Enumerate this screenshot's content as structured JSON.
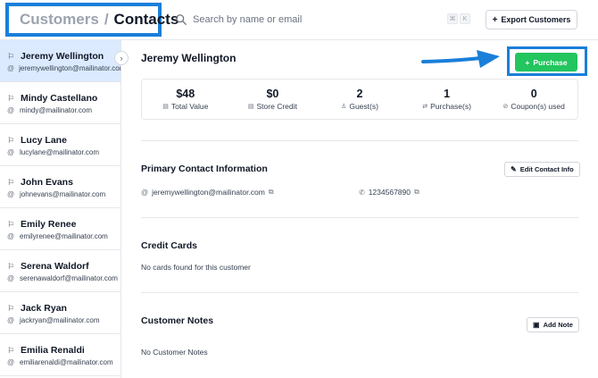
{
  "header": {
    "breadcrumb": {
      "parent": "Customers",
      "separator": "/",
      "current": "Contacts"
    },
    "search": {
      "placeholder": "Search by name or email",
      "shortcut_keys": [
        "⌘",
        "K"
      ]
    },
    "export_label": "Export Customers"
  },
  "sidebar": {
    "contacts": [
      {
        "name": "Jeremy Wellington",
        "email": "jeremywellington@mailinator.com",
        "active": true
      },
      {
        "name": "Mindy Castellano",
        "email": "mindy@mailinator.com",
        "active": false
      },
      {
        "name": "Lucy Lane",
        "email": "lucylane@mailinator.com",
        "active": false
      },
      {
        "name": "John Evans",
        "email": "johnevans@mailinator.com",
        "active": false
      },
      {
        "name": "Emily Renee",
        "email": "emilyrenee@mailinator.com",
        "active": false
      },
      {
        "name": "Serena Waldorf",
        "email": "serenawaldorf@mailinator.com",
        "active": false
      },
      {
        "name": "Jack Ryan",
        "email": "jackryan@mailinator.com",
        "active": false
      },
      {
        "name": "Emilia Renaldi",
        "email": "emiliarenaldi@mailinator.com",
        "active": false
      }
    ]
  },
  "customer": {
    "name": "Jeremy Wellington",
    "purchase_label": "Purchase",
    "stats": [
      {
        "value": "$48",
        "label": "Total Value",
        "icon": "wallet-icon"
      },
      {
        "value": "$0",
        "label": "Store Credit",
        "icon": "credit-icon"
      },
      {
        "value": "2",
        "label": "Guest(s)",
        "icon": "user-icon"
      },
      {
        "value": "1",
        "label": "Purchase(s)",
        "icon": "purchase-icon"
      },
      {
        "value": "0",
        "label": "Coupon(s) used",
        "icon": "coupon-icon"
      }
    ]
  },
  "primary_contact": {
    "title": "Primary Contact Information",
    "edit_label": "Edit Contact Info",
    "email": "jeremywellington@mailinator.com",
    "phone": "1234567890"
  },
  "credit_cards": {
    "title": "Credit Cards",
    "empty_text": "No cards found for this customer"
  },
  "notes": {
    "title": "Customer Notes",
    "add_label": "Add Note",
    "empty_text": "No Customer Notes"
  },
  "colors": {
    "accent_blue": "#1a7fd9",
    "purchase_green": "#22c55e",
    "active_row": "#dbeafe"
  }
}
